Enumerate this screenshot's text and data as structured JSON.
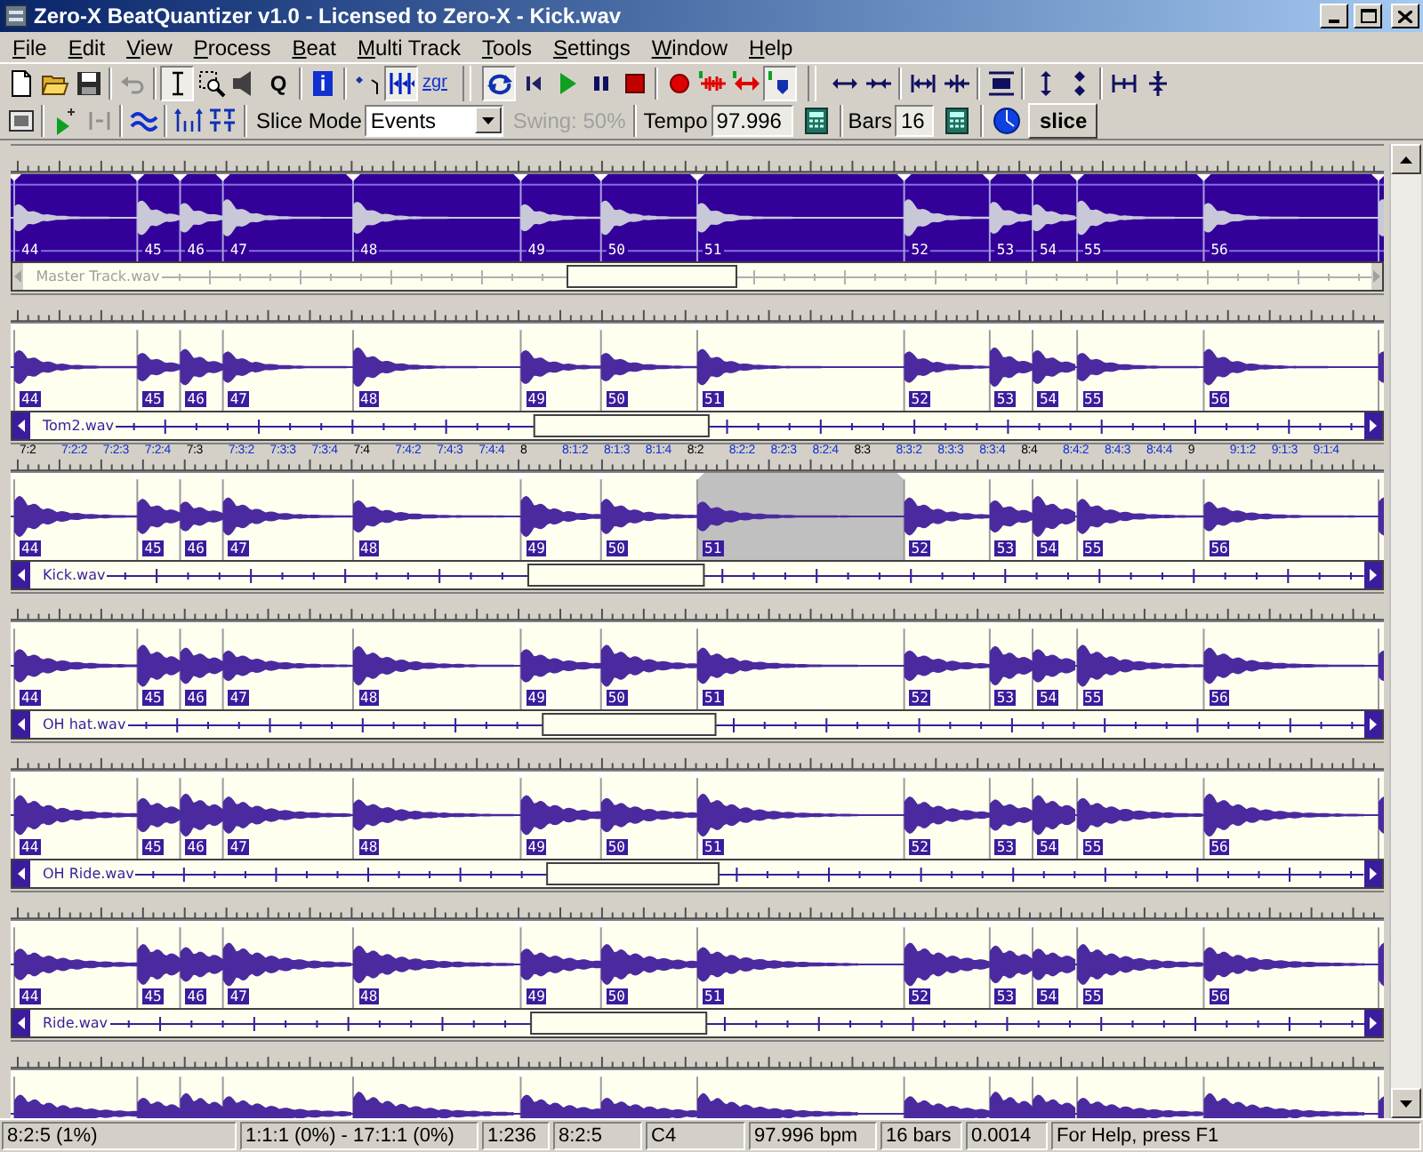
{
  "window": {
    "title": "Zero-X BeatQuantizer v1.0 - Licensed to Zero-X - Kick.wav"
  },
  "menu": [
    "File",
    "Edit",
    "View",
    "Process",
    "Beat",
    "Multi Track",
    "Tools",
    "Settings",
    "Window",
    "Help"
  ],
  "toolbar": [
    {
      "kind": "new",
      "pressed": false
    },
    {
      "kind": "open",
      "pressed": false
    },
    {
      "kind": "save",
      "pressed": false
    },
    {
      "kind": "separator"
    },
    {
      "kind": "undo",
      "pressed": false
    },
    {
      "kind": "separator"
    },
    {
      "kind": "ibeam",
      "pressed": true
    },
    {
      "kind": "zoom",
      "pressed": false
    },
    {
      "kind": "speaker",
      "pressed": false
    },
    {
      "kind": "letter",
      "text": "Q",
      "pressed": false
    },
    {
      "kind": "separator"
    },
    {
      "kind": "info",
      "text": "i",
      "pressed": false
    },
    {
      "kind": "separator"
    },
    {
      "kind": "marker",
      "pressed": false
    },
    {
      "kind": "triple",
      "pressed": true
    },
    {
      "kind": "zgr",
      "text": "zgr",
      "pressed": false
    },
    {
      "kind": "break"
    },
    {
      "kind": "loop",
      "pressed": true
    },
    {
      "kind": "tostart",
      "pressed": false
    },
    {
      "kind": "play",
      "pressed": false
    },
    {
      "kind": "pause",
      "pressed": false
    },
    {
      "kind": "stop",
      "pressed": false
    },
    {
      "kind": "separator"
    },
    {
      "kind": "record",
      "pressed": false
    },
    {
      "kind": "redwave",
      "pressed": false
    },
    {
      "kind": "redmerge",
      "pressed": false
    },
    {
      "kind": "blueflag",
      "pressed": true
    },
    {
      "kind": "break"
    },
    {
      "kind": "hexpand",
      "pressed": false
    },
    {
      "kind": "hshrink",
      "pressed": false
    },
    {
      "kind": "separator"
    },
    {
      "kind": "hfit",
      "pressed": false
    },
    {
      "kind": "hsplit",
      "pressed": false
    },
    {
      "kind": "separator"
    },
    {
      "kind": "vblock",
      "pressed": false
    },
    {
      "kind": "separator"
    },
    {
      "kind": "vexpand",
      "pressed": false
    },
    {
      "kind": "vshrink",
      "pressed": false
    },
    {
      "kind": "separator"
    },
    {
      "kind": "hbracket",
      "pressed": false
    },
    {
      "kind": "vsplit",
      "pressed": false
    }
  ],
  "toolbar2": [
    {
      "kind": "grid",
      "pressed": false
    },
    {
      "kind": "separator"
    },
    {
      "kind": "playmark",
      "pressed": false
    },
    {
      "kind": "bracketgrey",
      "pressed": false
    },
    {
      "kind": "separator"
    },
    {
      "kind": "bluewave",
      "pressed": false
    },
    {
      "kind": "separator"
    },
    {
      "kind": "beats",
      "pressed": false
    },
    {
      "kind": "tt",
      "pressed": false
    }
  ],
  "slice_mode": {
    "label": "Slice Mode",
    "value": "Events"
  },
  "swing": {
    "label": "Swing: 50%",
    "disabled": true
  },
  "tempo": {
    "label": "Tempo",
    "value": "97.996"
  },
  "bars": {
    "label": "Bars",
    "value": "16"
  },
  "slice_button": "slice",
  "tracks": [
    {
      "name": "Master Track.wav",
      "selected": true,
      "slices": [
        {
          "label": "44",
          "selected": false
        },
        {
          "label": "45",
          "selected": false
        },
        {
          "label": "46",
          "selected": false
        },
        {
          "label": "47",
          "selected": false
        },
        {
          "label": "48",
          "selected": false
        },
        {
          "label": "49",
          "selected": false
        },
        {
          "label": "50",
          "selected": false
        },
        {
          "label": "51",
          "selected": false
        },
        {
          "label": "52",
          "selected": false
        },
        {
          "label": "53",
          "selected": false
        },
        {
          "label": "54",
          "selected": false
        },
        {
          "label": "55",
          "selected": false
        },
        {
          "label": "56",
          "selected": false
        }
      ]
    },
    {
      "name": "Tom2.wav",
      "selected": false,
      "slices": [
        {
          "label": "44",
          "selected": false
        },
        {
          "label": "45",
          "selected": false
        },
        {
          "label": "46",
          "selected": false
        },
        {
          "label": "47",
          "selected": false
        },
        {
          "label": "48",
          "selected": false
        },
        {
          "label": "49",
          "selected": false
        },
        {
          "label": "50",
          "selected": false
        },
        {
          "label": "51",
          "selected": false
        },
        {
          "label": "52",
          "selected": false
        },
        {
          "label": "53",
          "selected": false
        },
        {
          "label": "54",
          "selected": false
        },
        {
          "label": "55",
          "selected": false
        },
        {
          "label": "56",
          "selected": false
        }
      ]
    },
    {
      "name": "Kick.wav",
      "selected": false,
      "ruler_labels": [
        {
          "label": "7:2",
          "kind": "beat"
        },
        {
          "label": "7:2:2",
          "kind": "sub"
        },
        {
          "label": "7:2:3",
          "kind": "sub"
        },
        {
          "label": "7:2:4",
          "kind": "sub"
        },
        {
          "label": "7:3",
          "kind": "beat"
        },
        {
          "label": "7:3:2",
          "kind": "sub"
        },
        {
          "label": "7:3:3",
          "kind": "sub"
        },
        {
          "label": "7:3:4",
          "kind": "sub"
        },
        {
          "label": "7:4",
          "kind": "beat"
        },
        {
          "label": "7:4:2",
          "kind": "sub"
        },
        {
          "label": "7:4:3",
          "kind": "sub"
        },
        {
          "label": "7:4:4",
          "kind": "sub"
        },
        {
          "label": "8",
          "kind": "beat"
        },
        {
          "label": "8:1:2",
          "kind": "sub"
        },
        {
          "label": "8:1:3",
          "kind": "sub"
        },
        {
          "label": "8:1:4",
          "kind": "sub"
        },
        {
          "label": "8:2",
          "kind": "beat"
        },
        {
          "label": "8:2:2",
          "kind": "sub"
        },
        {
          "label": "8:2:3",
          "kind": "sub"
        },
        {
          "label": "8:2:4",
          "kind": "sub"
        },
        {
          "label": "8:3",
          "kind": "beat"
        },
        {
          "label": "8:3:2",
          "kind": "sub"
        },
        {
          "label": "8:3:3",
          "kind": "sub"
        },
        {
          "label": "8:3:4",
          "kind": "sub"
        },
        {
          "label": "8:4",
          "kind": "beat"
        },
        {
          "label": "8:4:2",
          "kind": "sub"
        },
        {
          "label": "8:4:3",
          "kind": "sub"
        },
        {
          "label": "8:4:4",
          "kind": "sub"
        },
        {
          "label": "9",
          "kind": "beat"
        },
        {
          "label": "9:1:2",
          "kind": "sub"
        },
        {
          "label": "9:1:3",
          "kind": "sub"
        },
        {
          "label": "9:1:4",
          "kind": "sub"
        }
      ],
      "slices": [
        {
          "label": "44",
          "selected": false
        },
        {
          "label": "45",
          "selected": false
        },
        {
          "label": "46",
          "selected": false
        },
        {
          "label": "47",
          "selected": false
        },
        {
          "label": "48",
          "selected": false
        },
        {
          "label": "49",
          "selected": false
        },
        {
          "label": "50",
          "selected": false
        },
        {
          "label": "51",
          "selected": true
        },
        {
          "label": "52",
          "selected": false
        },
        {
          "label": "53",
          "selected": false
        },
        {
          "label": "54",
          "selected": false
        },
        {
          "label": "55",
          "selected": false
        },
        {
          "label": "56",
          "selected": false
        }
      ]
    },
    {
      "name": "OH hat.wav",
      "selected": false,
      "slices": [
        {
          "label": "44",
          "selected": false
        },
        {
          "label": "45",
          "selected": false
        },
        {
          "label": "46",
          "selected": false
        },
        {
          "label": "47",
          "selected": false
        },
        {
          "label": "48",
          "selected": false
        },
        {
          "label": "49",
          "selected": false
        },
        {
          "label": "50",
          "selected": false
        },
        {
          "label": "51",
          "selected": false
        },
        {
          "label": "52",
          "selected": false
        },
        {
          "label": "53",
          "selected": false
        },
        {
          "label": "54",
          "selected": false
        },
        {
          "label": "55",
          "selected": false
        },
        {
          "label": "56",
          "selected": false
        }
      ]
    },
    {
      "name": "OH Ride.wav",
      "selected": false,
      "slices": [
        {
          "label": "44",
          "selected": false
        },
        {
          "label": "45",
          "selected": false
        },
        {
          "label": "46",
          "selected": false
        },
        {
          "label": "47",
          "selected": false
        },
        {
          "label": "48",
          "selected": false
        },
        {
          "label": "49",
          "selected": false
        },
        {
          "label": "50",
          "selected": false
        },
        {
          "label": "51",
          "selected": false
        },
        {
          "label": "52",
          "selected": false
        },
        {
          "label": "53",
          "selected": false
        },
        {
          "label": "54",
          "selected": false
        },
        {
          "label": "55",
          "selected": false
        },
        {
          "label": "56",
          "selected": false
        }
      ]
    },
    {
      "name": "Ride.wav",
      "selected": false,
      "slices": [
        {
          "label": "44",
          "selected": false
        },
        {
          "label": "45",
          "selected": false
        },
        {
          "label": "46",
          "selected": false
        },
        {
          "label": "47",
          "selected": false
        },
        {
          "label": "48",
          "selected": false
        },
        {
          "label": "49",
          "selected": false
        },
        {
          "label": "50",
          "selected": false
        },
        {
          "label": "51",
          "selected": false
        },
        {
          "label": "52",
          "selected": false
        },
        {
          "label": "53",
          "selected": false
        },
        {
          "label": "54",
          "selected": false
        },
        {
          "label": "55",
          "selected": false
        },
        {
          "label": "56",
          "selected": false
        }
      ]
    },
    {
      "selected": false
    }
  ],
  "status_bar": [
    "8:2:5 (1%)",
    "1:1:1 (0%) - 17:1:1 (0%)",
    "1:236",
    "8:2:5",
    "C4",
    "97.996 bpm",
    "16 bars",
    "0.0014",
    "For Help, press F1"
  ]
}
